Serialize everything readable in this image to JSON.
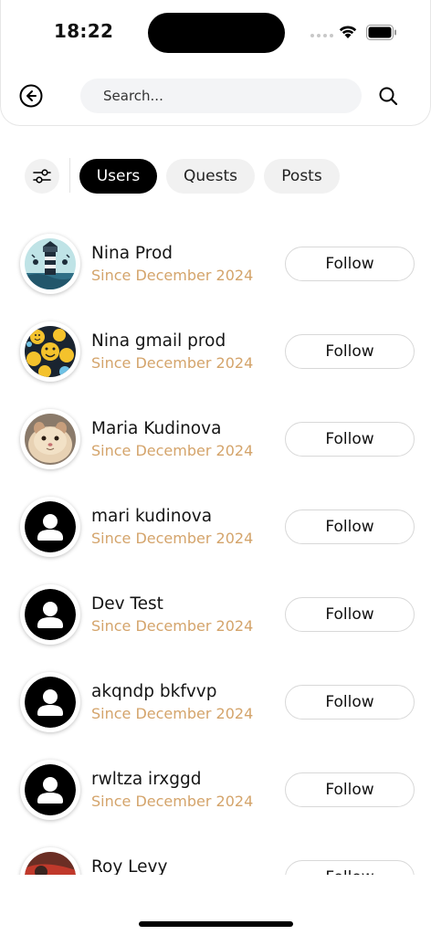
{
  "status_bar": {
    "time": "18:22"
  },
  "search": {
    "placeholder": "Search..."
  },
  "tabs": [
    {
      "label": "Users",
      "active": true
    },
    {
      "label": "Quests",
      "active": false
    },
    {
      "label": "Posts",
      "active": false
    }
  ],
  "users": [
    {
      "name": "Nina Prod",
      "since": "Since December 2024",
      "follow_label": "Follow",
      "avatar": "lighthouse-photo"
    },
    {
      "name": "Nina gmail prod",
      "since": "Since December 2024",
      "follow_label": "Follow",
      "avatar": "smiley-faces-photo"
    },
    {
      "name": "Maria Kudinova",
      "since": "Since December 2024",
      "follow_label": "Follow",
      "avatar": "hamster-photo"
    },
    {
      "name": "mari kudinova",
      "since": "Since December 2024",
      "follow_label": "Follow",
      "avatar": "default-user-icon"
    },
    {
      "name": "Dev Test",
      "since": "Since December 2024",
      "follow_label": "Follow",
      "avatar": "default-user-icon"
    },
    {
      "name": "akqndp bkfvvp",
      "since": "Since December 2024",
      "follow_label": "Follow",
      "avatar": "default-user-icon"
    },
    {
      "name": "rwltza irxggd",
      "since": "Since December 2024",
      "follow_label": "Follow",
      "avatar": "default-user-icon"
    },
    {
      "name": "Roy Levy",
      "since": "",
      "follow_label": "Follow",
      "avatar": "red-photo"
    }
  ],
  "colors": {
    "accent_text": "#d4a46b",
    "active_tab_bg": "#000000"
  }
}
